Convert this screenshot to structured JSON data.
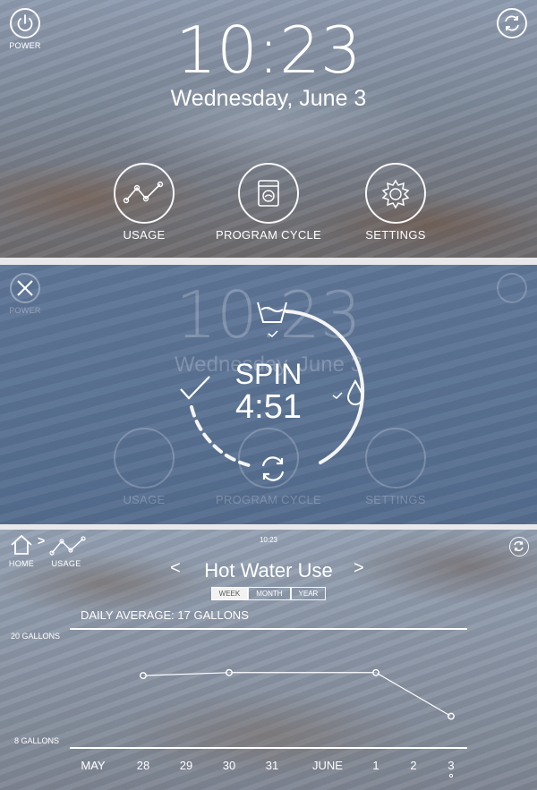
{
  "home": {
    "power_label": "POWER",
    "time": "10:23",
    "date": "Wednesday, June 3",
    "nav": [
      {
        "label": "USAGE"
      },
      {
        "label": "PROGRAM CYCLE"
      },
      {
        "label": "SETTINGS"
      }
    ]
  },
  "cycle": {
    "power_label": "POWER",
    "bg_time": "10:23",
    "bg_date": "Wednesday, June 3",
    "stage": "SPIN",
    "remaining": "4:51",
    "bg_nav": [
      "USAGE",
      "PROGRAM CYCLE",
      "SETTINGS"
    ]
  },
  "usage": {
    "breadcrumb_home": "HOME",
    "breadcrumb_usage": "USAGE",
    "small_time": "10:23",
    "title": "Hot Water Use",
    "prev_glyph": "<",
    "next_glyph": ">",
    "tabs": [
      {
        "label": "WEEK",
        "active": true
      },
      {
        "label": "MONTH",
        "active": false
      },
      {
        "label": "YEAR",
        "active": false
      }
    ],
    "daily_average": "DAILY AVERAGE: 17 GALLONS",
    "ymax_label": "20 GALLONS",
    "ymin_label": "8 GALLONS",
    "x_labels": [
      "MAY",
      "28",
      "29",
      "30",
      "31",
      "JUNE",
      "1",
      "2",
      "3"
    ]
  },
  "chart_data": {
    "type": "line",
    "title": "Hot Water Use",
    "ylabel": "",
    "ylim": [
      8,
      20
    ],
    "categories": [
      "MAY",
      "28",
      "29",
      "30",
      "31",
      "JUNE",
      "1",
      "2",
      "3"
    ],
    "points": [
      {
        "x": "28",
        "y": 15.3
      },
      {
        "x": "30",
        "y": 15.6
      },
      {
        "x": "1",
        "y": 15.6
      },
      {
        "x": "3",
        "y": 11.2
      }
    ]
  },
  "colors": {
    "accent": "#ffffff",
    "tab_active_bg": "#f2f2f2"
  }
}
